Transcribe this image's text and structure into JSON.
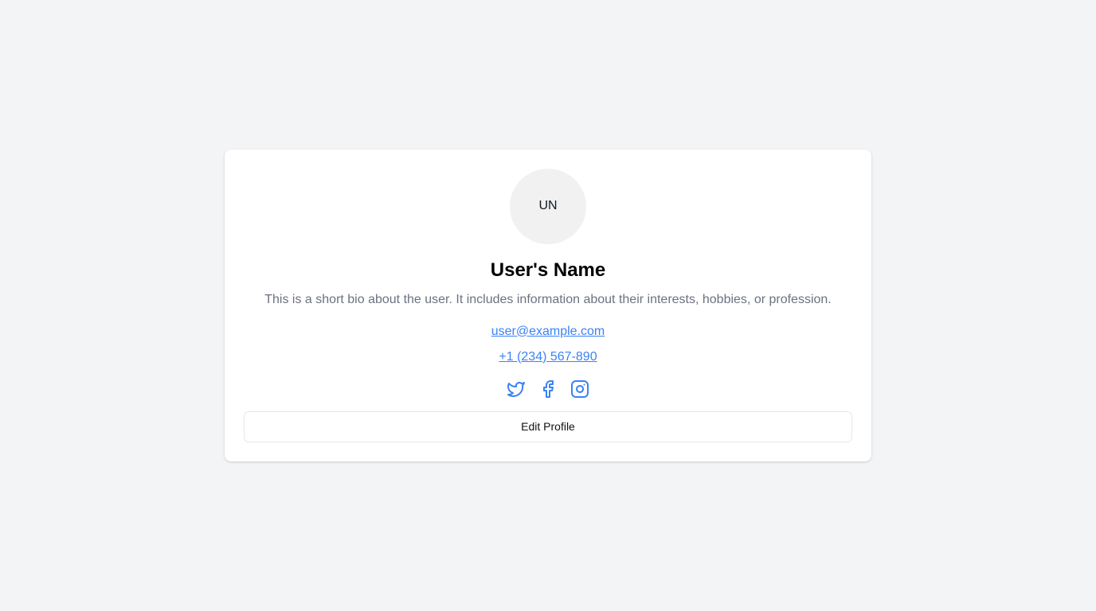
{
  "profile": {
    "avatar_initials": "UN",
    "name": "User's Name",
    "bio": "This is a short bio about the user. It includes information about their interests, hobbies, or profession.",
    "email": "user@example.com",
    "phone": "+1 (234) 567-890"
  },
  "socials": [
    {
      "icon": "twitter-icon"
    },
    {
      "icon": "facebook-icon"
    },
    {
      "icon": "instagram-icon"
    }
  ],
  "actions": {
    "edit_label": "Edit Profile"
  },
  "colors": {
    "background": "#f3f4f6",
    "card": "#ffffff",
    "link": "#3b82f6",
    "bio_text": "#6b7280",
    "avatar_bg": "#f1f1f1",
    "border": "#e5e7eb"
  }
}
